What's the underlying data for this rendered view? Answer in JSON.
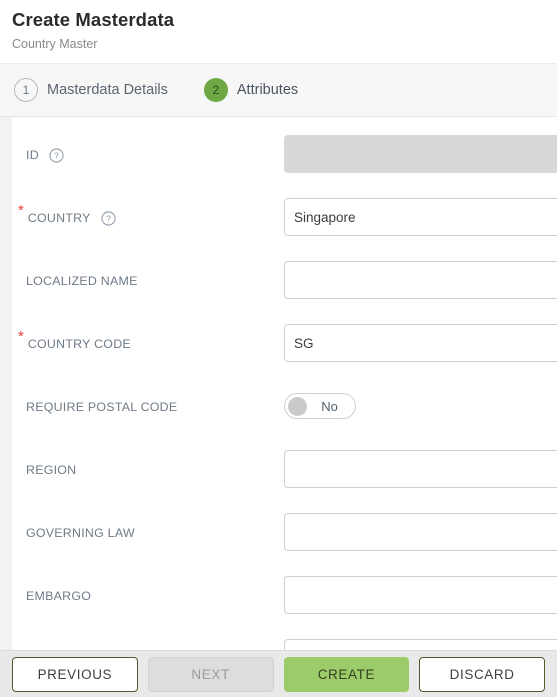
{
  "header": {
    "title": "Create Masterdata",
    "subtitle": "Country Master"
  },
  "steps": [
    {
      "number": "1",
      "label": "Masterdata Details",
      "active": false
    },
    {
      "number": "2",
      "label": "Attributes",
      "active": true
    }
  ],
  "form": {
    "fields": [
      {
        "label": "ID",
        "required": false,
        "help": true,
        "help_icon": "question-circle-icon",
        "type": "text",
        "value": "",
        "placeholder": "",
        "disabled": true
      },
      {
        "label": "COUNTRY",
        "required": true,
        "help": true,
        "help_icon": "question-circle-icon",
        "type": "text",
        "value": "Singapore",
        "placeholder": "",
        "disabled": false
      },
      {
        "label": "LOCALIZED NAME",
        "required": false,
        "help": false,
        "type": "text",
        "value": "",
        "placeholder": "",
        "disabled": false
      },
      {
        "label": "COUNTRY CODE",
        "required": true,
        "help": false,
        "type": "text",
        "value": "SG",
        "placeholder": "",
        "disabled": false
      },
      {
        "label": "REQUIRE POSTAL CODE",
        "required": false,
        "help": false,
        "type": "toggle",
        "value": "No",
        "checked": false,
        "disabled": false
      },
      {
        "label": "REGION",
        "required": false,
        "help": false,
        "type": "text",
        "value": "",
        "placeholder": "",
        "disabled": false
      },
      {
        "label": "GOVERNING LAW",
        "required": false,
        "help": false,
        "type": "text",
        "value": "",
        "placeholder": "",
        "disabled": false
      },
      {
        "label": "EMBARGO",
        "required": false,
        "help": false,
        "type": "text",
        "value": "",
        "placeholder": "",
        "disabled": false
      }
    ]
  },
  "footer": {
    "buttons": [
      {
        "label": "PREVIOUS",
        "style": "outline",
        "disabled": false
      },
      {
        "label": "NEXT",
        "style": "disabled",
        "disabled": true
      },
      {
        "label": "CREATE",
        "style": "primary",
        "disabled": false
      },
      {
        "label": "DISCARD",
        "style": "outline",
        "disabled": false
      }
    ]
  },
  "colors": {
    "accent_green": "#9ccc6a",
    "step_active_green": "#6fa845",
    "required_red": "#e8413a",
    "outline_border": "#4b5d28",
    "footer_bg": "#e9e9e9",
    "disabled_input": "#d8d8d8"
  }
}
